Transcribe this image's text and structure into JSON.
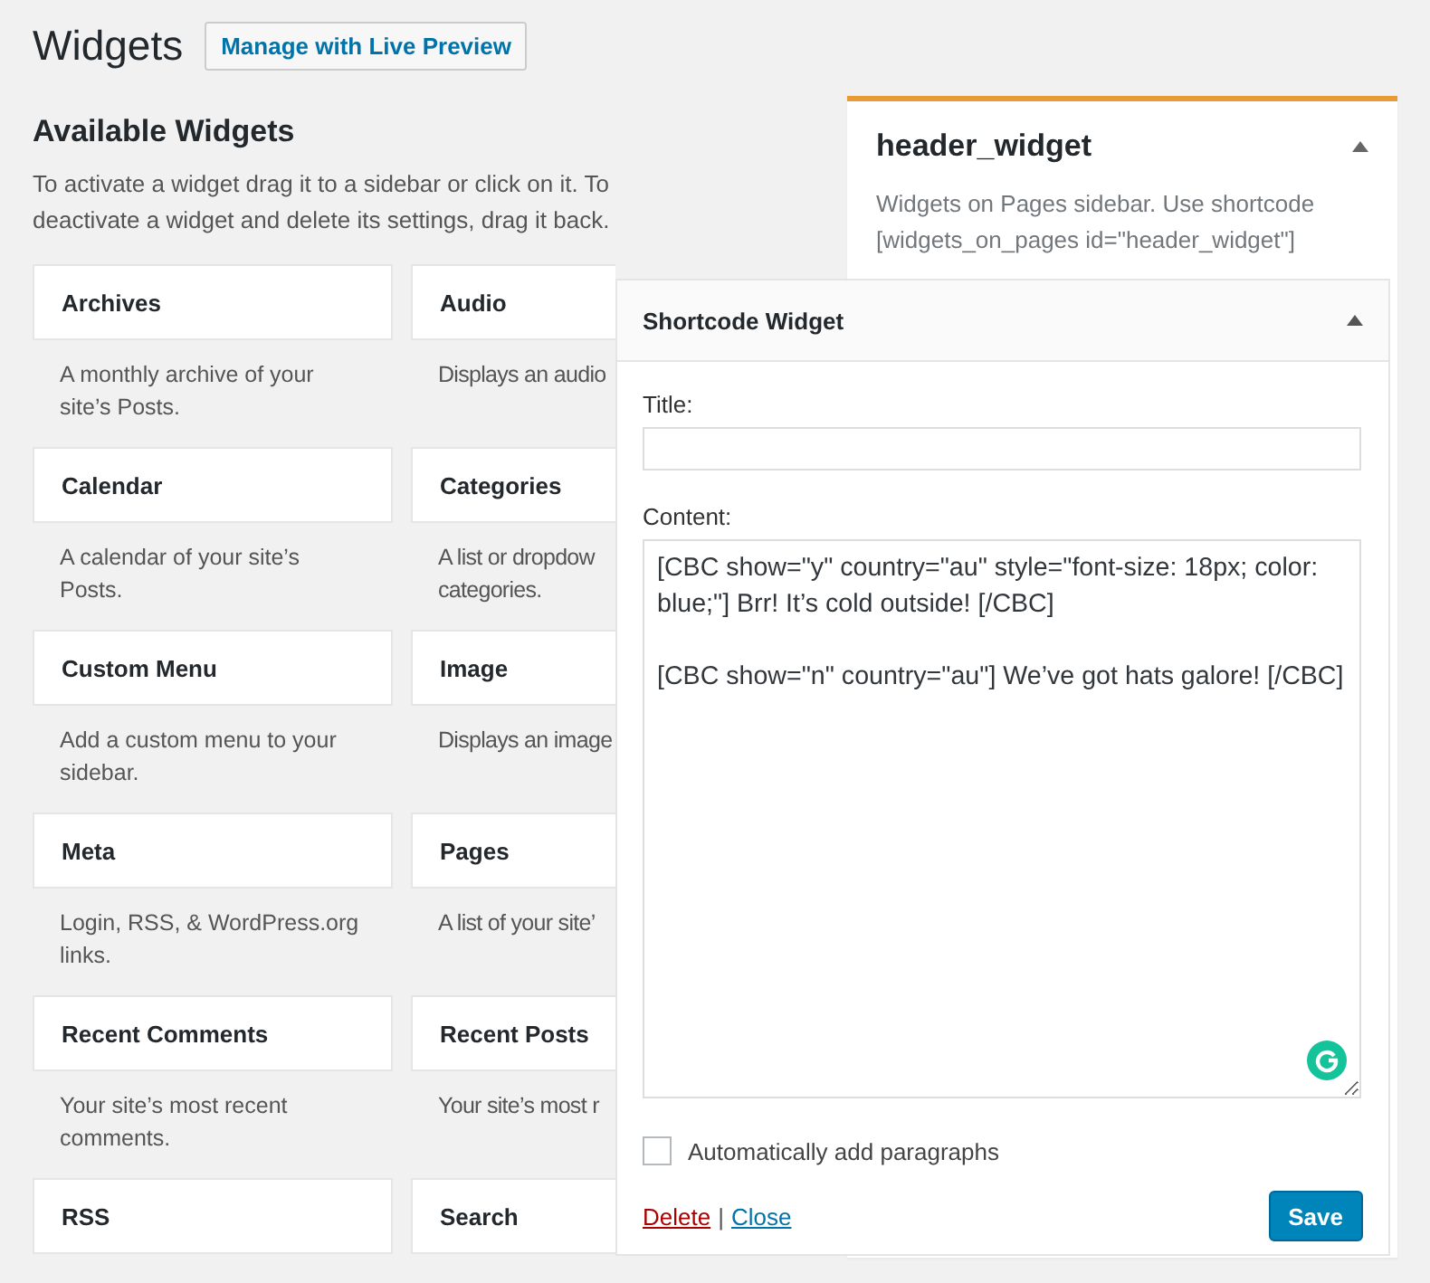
{
  "page": {
    "title": "Widgets",
    "action": "Manage with Live Preview"
  },
  "available": {
    "heading": "Available Widgets",
    "description": "To activate a widget drag it to a sidebar or click on it. To deactivate a widget and delete its settings, drag it back.",
    "widgets": [
      {
        "name": "Archives",
        "description": "A monthly archive of your site’s Posts."
      },
      {
        "name": "Audio",
        "description": "Displays an audio"
      },
      {
        "name": "Calendar",
        "description": "A calendar of your site’s Posts."
      },
      {
        "name": "Categories",
        "description": "A list or dropdow categories."
      },
      {
        "name": "Custom Menu",
        "description": "Add a custom menu to your sidebar."
      },
      {
        "name": "Image",
        "description": "Displays an image"
      },
      {
        "name": "Meta",
        "description": "Login, RSS, & WordPress.org links."
      },
      {
        "name": "Pages",
        "description": "A list of your site’"
      },
      {
        "name": "Recent Comments",
        "description": "Your site’s most recent comments."
      },
      {
        "name": "Recent Posts",
        "description": "Your site’s most r"
      },
      {
        "name": "RSS"
      },
      {
        "name": "Search"
      }
    ]
  },
  "sidebar": {
    "title": "header_widget",
    "expanded": true,
    "description": "Widgets on Pages sidebar. Use shortcode [widgets_on_pages id=\"header_widget\"]"
  },
  "widget_form": {
    "title": "Shortcode Widget",
    "expanded": true,
    "title_label": "Title:",
    "content_label": "Content:",
    "content": "[CBC show=\"y\" country=\"au\" style=\"font-size: 18px; color: blue;\"] Brr! It’s cold outside! [/CBC]\n\n[CBC show=\"n\" country=\"au\"] We’ve got hats galore! [/CBC]",
    "checkbox": {
      "label": "Automatically add paragraphs",
      "checked": false
    },
    "delete": "Delete",
    "separator": "|",
    "close": "Close",
    "save": "Save"
  }
}
